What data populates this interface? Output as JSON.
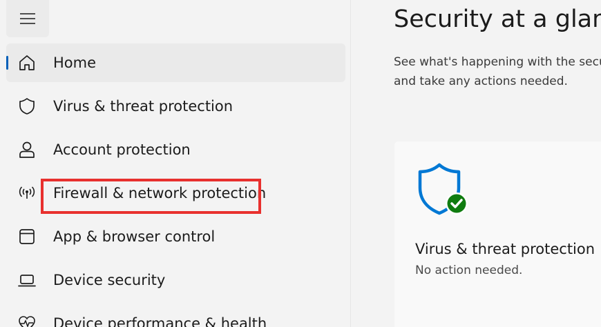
{
  "sidebar": {
    "menu_icon": "hamburger-menu-icon",
    "items": [
      {
        "label": "Home",
        "icon": "home-icon",
        "selected": true
      },
      {
        "label": "Virus & threat protection",
        "icon": "shield-icon"
      },
      {
        "label": "Account protection",
        "icon": "person-icon"
      },
      {
        "label": "Firewall & network protection",
        "icon": "antenna-icon",
        "highlighted": true
      },
      {
        "label": "App & browser control",
        "icon": "app-window-icon"
      },
      {
        "label": "Device security",
        "icon": "laptop-icon"
      },
      {
        "label": "Device performance & health",
        "icon": "heart-pulse-icon"
      }
    ]
  },
  "main": {
    "title": "Security at a glance",
    "description": "See what's happening with the security and health of your device\nand take any actions needed.",
    "cards": [
      {
        "title": "Virus & threat protection",
        "status": "No action needed.",
        "icon": "shield-check-icon",
        "status_color": "#107c10",
        "icon_color": "#0078d4"
      }
    ]
  },
  "colors": {
    "accent": "#005fb8",
    "highlight": "#e8302e",
    "ok": "#107c10"
  }
}
